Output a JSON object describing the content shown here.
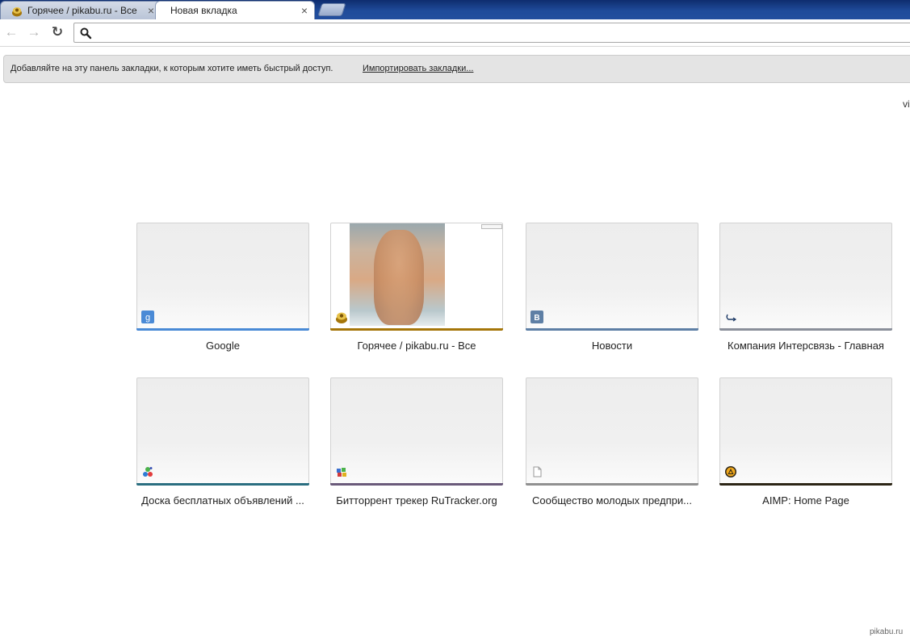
{
  "tabs": [
    {
      "title": "Горячее / pikabu.ru - Все",
      "active": false,
      "close": "×"
    },
    {
      "title": "Новая вкладка",
      "active": true,
      "close": "×"
    }
  ],
  "toolbar": {
    "back_icon": "←",
    "forward_icon": "→",
    "reload_icon": "↻",
    "omnibox_value": "",
    "omnibox_placeholder": ""
  },
  "bookmark_bar": {
    "message": "Добавляйте на эту панель закладки, к которым хотите иметь быстрый доступ.",
    "import_link": "Импортировать закладки..."
  },
  "corner_text": "vi",
  "most_visited": [
    {
      "label": "Google",
      "icon": "google-g-icon",
      "color": "#4a8ad6"
    },
    {
      "label": "Горячее / pikabu.ru - Все",
      "icon": "pikabu-icon",
      "color": "#a5760a"
    },
    {
      "label": "Новости",
      "icon": "vk-icon",
      "color": "#5e7fa5"
    },
    {
      "label": "Компания Интерсвязь - Главная",
      "icon": "intersvyaz-icon",
      "color": "#8a8f9a"
    },
    {
      "label": "Доска бесплатных объявлений ...",
      "icon": "avito-icon",
      "color": "#2a6e80"
    },
    {
      "label": "Битторрент трекер RuTracker.org",
      "icon": "rutracker-icon",
      "color": "#6a5a7a"
    },
    {
      "label": "Сообщество молодых предпри...",
      "icon": "page-icon",
      "color": "#909090"
    },
    {
      "label": "AIMP: Home Page",
      "icon": "aimp-icon",
      "color": "#2c2516"
    }
  ],
  "watermark": "pikabu.ru"
}
